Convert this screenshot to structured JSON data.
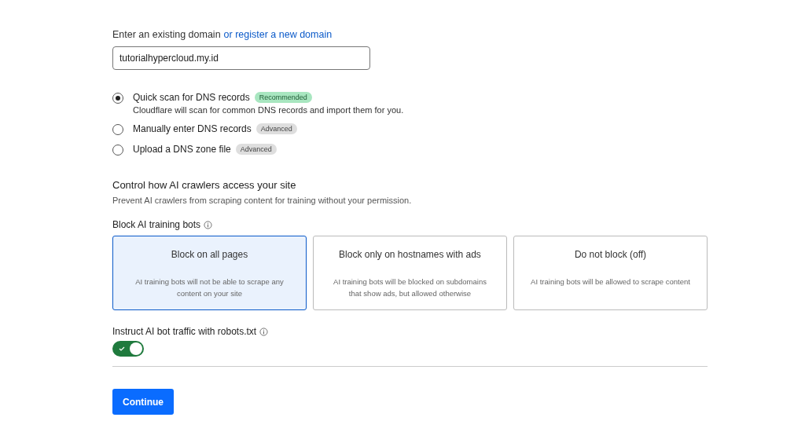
{
  "domain": {
    "label": "Enter an existing domain",
    "link": "or register a new domain",
    "value": "tutorialhypercloud.my.id"
  },
  "scan_options": [
    {
      "label": "Quick scan for DNS records",
      "badge": "Recommended",
      "kind": "recommended",
      "description": "Cloudflare will scan for common DNS records and import them for you.",
      "selected": true
    },
    {
      "label": "Manually enter DNS records",
      "badge": "Advanced",
      "kind": "advanced",
      "selected": false
    },
    {
      "label": "Upload a DNS zone file",
      "badge": "Advanced",
      "kind": "advanced",
      "selected": false
    }
  ],
  "ai_section": {
    "title": "Control how AI crawlers access your site",
    "subtitle": "Prevent AI crawlers from scraping content for training without your permission."
  },
  "block_bots": {
    "label": "Block AI training bots",
    "options": [
      {
        "title": "Block on all pages",
        "description": "AI training bots will not be able to scrape any content on your site",
        "selected": true
      },
      {
        "title": "Block only on hostnames with ads",
        "description": "AI training bots will be blocked on subdomains that show ads, but allowed otherwise",
        "selected": false
      },
      {
        "title": "Do not block (off)",
        "description": "AI training bots will be allowed to scrape content",
        "selected": false
      }
    ]
  },
  "robots": {
    "label": "Instruct AI bot traffic with robots.txt",
    "on": true
  },
  "continue_button": "Continue"
}
